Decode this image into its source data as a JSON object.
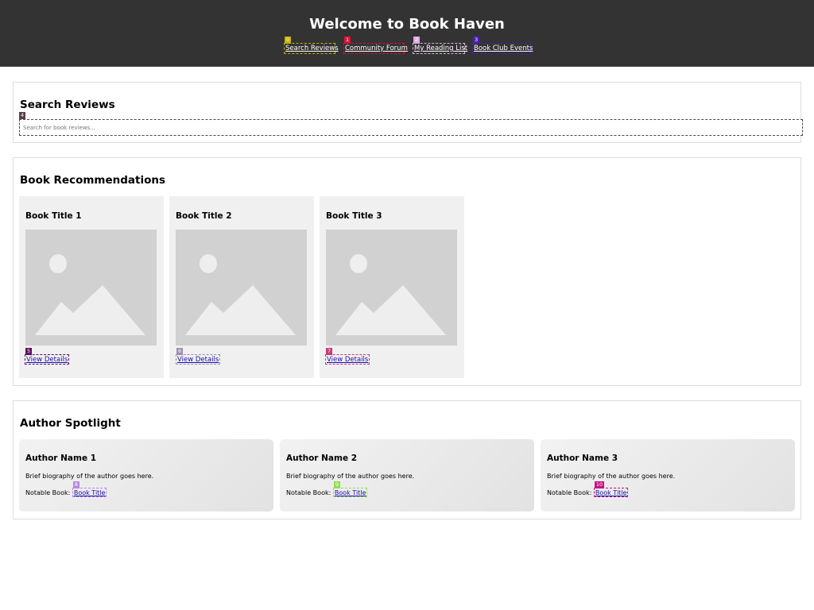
{
  "header": {
    "title": "Welcome to Book Haven",
    "nav": [
      {
        "label": "Search Reviews",
        "tag": "0",
        "color": "#c8b400"
      },
      {
        "label": "Community Forum",
        "tag": "1",
        "color": "#e0103a"
      },
      {
        "label": "My Reading List",
        "tag": "2",
        "color": "#e0a8e8"
      },
      {
        "label": "Book Club Events",
        "tag": "3",
        "color": "#4a1fb8"
      }
    ]
  },
  "search": {
    "heading": "Search Reviews",
    "placeholder": "Search for book reviews...",
    "tag": "4",
    "color": "#5a3f4a"
  },
  "recommendations": {
    "heading": "Book Recommendations",
    "books": [
      {
        "title": "Book Title 1",
        "link": "View Details",
        "tag": "5",
        "color": "#5c1060"
      },
      {
        "title": "Book Title 2",
        "link": "View Details",
        "tag": "6",
        "color": "#9c8fae"
      },
      {
        "title": "Book Title 3",
        "link": "View Details",
        "tag": "7",
        "color": "#c83a78"
      }
    ]
  },
  "authors": {
    "heading": "Author Spotlight",
    "items": [
      {
        "name": "Author Name 1",
        "bio": "Brief biography of the author goes here.",
        "notable_label": "Notable Book:",
        "book": "Book Title",
        "tag": "8",
        "color": "#b88ae0"
      },
      {
        "name": "Author Name 2",
        "bio": "Brief biography of the author goes here.",
        "notable_label": "Notable Book:",
        "book": "Book Title",
        "tag": "9",
        "color": "#8ee04a"
      },
      {
        "name": "Author Name 3",
        "bio": "Brief biography of the author goes here.",
        "notable_label": "Notable Book:",
        "book": "Book Title",
        "tag": "10",
        "color": "#c8108a"
      }
    ]
  }
}
